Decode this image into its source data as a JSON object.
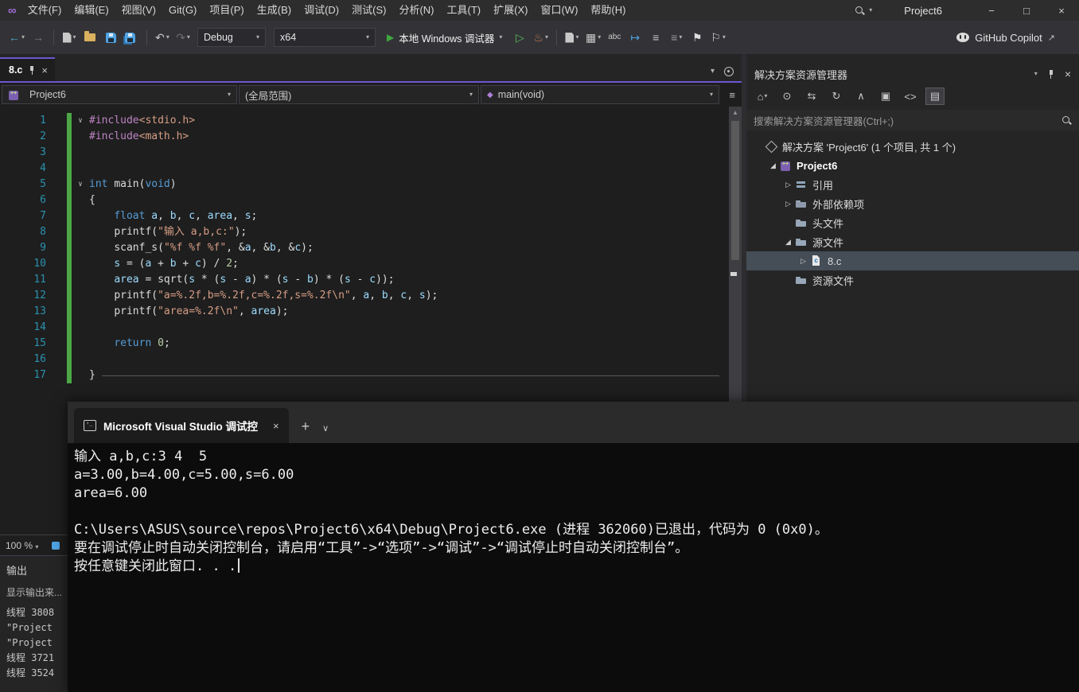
{
  "colors": {
    "accent": "#6E56CF",
    "green_bar": "#4CA646",
    "selection": "#454D57",
    "titlebar_bg": "#2D2D2D",
    "toolbar_bg": "#333337",
    "editor_bg": "#1E1E1E",
    "panel_bg": "#252526",
    "console_bg": "#0C0C0C",
    "debug_green": "#3FA83F",
    "syn_keyword": "#569CD6",
    "syn_string": "#D69D85",
    "syn_number": "#B5CEA8",
    "syn_preproc": "#BD85C4",
    "syn_variable": "#9CDCFE",
    "syn_plain": "#DCDCDC",
    "syn_linenum": "#2B91AF"
  },
  "titlebar": {
    "project_name": "Project6",
    "menus": [
      "文件(F)",
      "编辑(E)",
      "视图(V)",
      "Git(G)",
      "项目(P)",
      "生成(B)",
      "调试(D)",
      "测试(S)",
      "分析(N)",
      "工具(T)",
      "扩展(X)",
      "窗口(W)",
      "帮助(H)"
    ],
    "window_controls": [
      {
        "name": "minimize-button",
        "glyph": "−"
      },
      {
        "name": "maximize-button",
        "glyph": "□"
      },
      {
        "name": "close-button",
        "glyph": "×"
      }
    ]
  },
  "toolbar": {
    "items": [
      {
        "type": "icon",
        "name": "navigate-backward-button",
        "glyph": "←",
        "color": "#4DAACD",
        "caret": true
      },
      {
        "type": "icon",
        "name": "navigate-forward-button",
        "glyph": "→",
        "color": "#7A7A7A"
      },
      {
        "type": "sep"
      },
      {
        "type": "icon",
        "name": "new-project-button",
        "shape": "doc",
        "caret": true
      },
      {
        "type": "icon",
        "name": "open-file-button",
        "shape": "folder"
      },
      {
        "type": "icon",
        "name": "save-button",
        "shape": "floppy"
      },
      {
        "type": "icon",
        "name": "save-all-button",
        "shape": "floppy2"
      },
      {
        "type": "sep"
      },
      {
        "type": "icon",
        "name": "undo-button",
        "glyph": "↶",
        "color": "#C8C8C8",
        "caret": true
      },
      {
        "type": "icon",
        "name": "redo-button",
        "glyph": "↷",
        "color": "#6E6E6E",
        "caret": true
      },
      {
        "type": "combo",
        "name": "solution-configurations-dropdown",
        "value": "Debug",
        "width": 86
      },
      {
        "type": "combo",
        "name": "solution-platforms-dropdown",
        "value": "x64",
        "width": 128
      },
      {
        "type": "run",
        "name": "start-debugging-button",
        "label": "本地 Windows 调试器",
        "caret": true
      },
      {
        "type": "icon",
        "name": "start-without-debugging-button",
        "glyph": "▷",
        "color": "#57B957"
      },
      {
        "type": "icon",
        "name": "hot-reload-button",
        "glyph": "♨",
        "color": "#C97A53",
        "caret": true
      },
      {
        "type": "sep"
      },
      {
        "type": "icon",
        "name": "new-editor-window-button",
        "shape": "doc",
        "caret": true
      },
      {
        "type": "icon",
        "name": "window-layout-button",
        "glyph": "▦",
        "color": "#C8C8C8",
        "caret": true
      },
      {
        "type": "icon",
        "name": "spell-checker-button",
        "glyph": "abc",
        "color": "#C8C8C8"
      },
      {
        "type": "icon",
        "name": "navigate-to-button",
        "glyph": "↦",
        "color": "#4FA3E3"
      },
      {
        "type": "icon",
        "name": "show-whitespace-button",
        "glyph": "≡",
        "color": "#C8C8C8"
      },
      {
        "type": "icon",
        "name": "indent-guides-button",
        "glyph": "≡",
        "color": "#9A9A9A",
        "caret": true
      },
      {
        "type": "icon",
        "name": "toggle-bookmark-button",
        "glyph": "⚑",
        "color": "#DDDDDD"
      },
      {
        "type": "icon",
        "name": "bookmark-window-button",
        "glyph": "⚐",
        "color": "#DDDDDD",
        "caret": true
      },
      {
        "type": "spacer"
      },
      {
        "type": "copilot",
        "name": "github-copilot-button",
        "label": "GitHub Copilot"
      }
    ]
  },
  "editor": {
    "tab_label": "8.c",
    "nav_project": "Project6",
    "nav_scope": "(全局范围)",
    "nav_member": "main(void)",
    "zoom": "100 %",
    "lines": [
      {
        "n": 1,
        "fold": true,
        "segs": [
          [
            "pp",
            "#include"
          ],
          [
            "hdr",
            "<stdio.h>"
          ]
        ]
      },
      {
        "n": 2,
        "segs": [
          [
            "pp",
            "#include"
          ],
          [
            "hdr",
            "<math.h>"
          ]
        ]
      },
      {
        "n": 3,
        "segs": []
      },
      {
        "n": 4,
        "segs": []
      },
      {
        "n": 5,
        "fold": true,
        "segs": [
          [
            "kw",
            "int"
          ],
          [
            "pl",
            " "
          ],
          [
            "fn",
            "main"
          ],
          [
            "pl",
            "("
          ],
          [
            "kw",
            "void"
          ],
          [
            "pl",
            ")"
          ]
        ]
      },
      {
        "n": 6,
        "segs": [
          [
            "pl",
            "{"
          ]
        ]
      },
      {
        "n": 7,
        "segs": [
          [
            "pl",
            "    "
          ],
          [
            "kw",
            "float"
          ],
          [
            "pl",
            " "
          ],
          [
            "var",
            "a"
          ],
          [
            "pl",
            ", "
          ],
          [
            "var",
            "b"
          ],
          [
            "pl",
            ", "
          ],
          [
            "var",
            "c"
          ],
          [
            "pl",
            ", "
          ],
          [
            "var",
            "area"
          ],
          [
            "pl",
            ", "
          ],
          [
            "var",
            "s"
          ],
          [
            "pl",
            ";"
          ]
        ]
      },
      {
        "n": 8,
        "segs": [
          [
            "pl",
            "    "
          ],
          [
            "fn",
            "printf"
          ],
          [
            "pl",
            "("
          ],
          [
            "str",
            "\"输入 a,b,c:\""
          ],
          [
            "pl",
            ");"
          ]
        ]
      },
      {
        "n": 9,
        "segs": [
          [
            "pl",
            "    "
          ],
          [
            "fn",
            "scanf_s"
          ],
          [
            "pl",
            "("
          ],
          [
            "str",
            "\"%f %f %f\""
          ],
          [
            "pl",
            ", &"
          ],
          [
            "var",
            "a"
          ],
          [
            "pl",
            ", &"
          ],
          [
            "var",
            "b"
          ],
          [
            "pl",
            ", &"
          ],
          [
            "var",
            "c"
          ],
          [
            "pl",
            ");"
          ]
        ]
      },
      {
        "n": 10,
        "segs": [
          [
            "pl",
            "    "
          ],
          [
            "var",
            "s"
          ],
          [
            "pl",
            " = ("
          ],
          [
            "var",
            "a"
          ],
          [
            "pl",
            " + "
          ],
          [
            "var",
            "b"
          ],
          [
            "pl",
            " + "
          ],
          [
            "var",
            "c"
          ],
          [
            "pl",
            ") / "
          ],
          [
            "num",
            "2"
          ],
          [
            "pl",
            ";"
          ]
        ]
      },
      {
        "n": 11,
        "segs": [
          [
            "pl",
            "    "
          ],
          [
            "var",
            "area"
          ],
          [
            "pl",
            " = "
          ],
          [
            "fn",
            "sqrt"
          ],
          [
            "pl",
            "("
          ],
          [
            "var",
            "s"
          ],
          [
            "pl",
            " * ("
          ],
          [
            "var",
            "s"
          ],
          [
            "pl",
            " - "
          ],
          [
            "var",
            "a"
          ],
          [
            "pl",
            ") * ("
          ],
          [
            "var",
            "s"
          ],
          [
            "pl",
            " - "
          ],
          [
            "var",
            "b"
          ],
          [
            "pl",
            ") * ("
          ],
          [
            "var",
            "s"
          ],
          [
            "pl",
            " - "
          ],
          [
            "var",
            "c"
          ],
          [
            "pl",
            "));"
          ]
        ]
      },
      {
        "n": 12,
        "segs": [
          [
            "pl",
            "    "
          ],
          [
            "fn",
            "printf"
          ],
          [
            "pl",
            "("
          ],
          [
            "str",
            "\"a=%.2f,b=%.2f,c=%.2f,s=%.2f\\n\""
          ],
          [
            "pl",
            ", "
          ],
          [
            "var",
            "a"
          ],
          [
            "pl",
            ", "
          ],
          [
            "var",
            "b"
          ],
          [
            "pl",
            ", "
          ],
          [
            "var",
            "c"
          ],
          [
            "pl",
            ", "
          ],
          [
            "var",
            "s"
          ],
          [
            "pl",
            ");"
          ]
        ]
      },
      {
        "n": 13,
        "segs": [
          [
            "pl",
            "    "
          ],
          [
            "fn",
            "printf"
          ],
          [
            "pl",
            "("
          ],
          [
            "str",
            "\"area=%.2f\\n\""
          ],
          [
            "pl",
            ", "
          ],
          [
            "var",
            "area"
          ],
          [
            "pl",
            ");"
          ]
        ]
      },
      {
        "n": 14,
        "segs": []
      },
      {
        "n": 15,
        "segs": [
          [
            "pl",
            "    "
          ],
          [
            "kw",
            "return"
          ],
          [
            "pl",
            " "
          ],
          [
            "num",
            "0"
          ],
          [
            "pl",
            ";"
          ]
        ]
      },
      {
        "n": 16,
        "segs": []
      },
      {
        "n": 17,
        "segs": [
          [
            "pl",
            "}"
          ]
        ],
        "endline": true
      }
    ]
  },
  "solution_explorer": {
    "title": "解决方案资源管理器",
    "search_placeholder": "搜索解决方案资源管理器(Ctrl+;)",
    "toolbar": [
      {
        "name": "switch-views-button",
        "glyph": "⌂",
        "caret": true
      },
      {
        "name": "pending-changes-filter-button",
        "glyph": "⊙"
      },
      {
        "name": "sync-with-active-document-button",
        "glyph": "⇆"
      },
      {
        "name": "refresh-button",
        "glyph": "↻"
      },
      {
        "name": "collapse-all-button",
        "glyph": "∧"
      },
      {
        "name": "properties-button",
        "glyph": "▣"
      },
      {
        "name": "view-code-button",
        "glyph": "<>"
      },
      {
        "name": "preview-selected-items-toggle",
        "glyph": "▤",
        "active": true
      }
    ],
    "tree": [
      {
        "label": "解决方案 'Project6' (1 个项目, 共 1 个)",
        "icon": "solution",
        "depth": 0,
        "arrow": ""
      },
      {
        "label": "Project6",
        "icon": "project",
        "depth": 1,
        "arrow": "expanded",
        "bold": true
      },
      {
        "label": "引用",
        "icon": "references",
        "depth": 2,
        "arrow": "collapsed"
      },
      {
        "label": "外部依赖项",
        "icon": "dependencies",
        "depth": 2,
        "arrow": "collapsed"
      },
      {
        "label": "头文件",
        "icon": "folder",
        "depth": 2,
        "arrow": ""
      },
      {
        "label": "源文件",
        "icon": "folder",
        "depth": 2,
        "arrow": "expanded"
      },
      {
        "label": "8.c",
        "icon": "c-file",
        "depth": 3,
        "arrow": "collapsed",
        "selected": true
      },
      {
        "label": "资源文件",
        "icon": "folder",
        "depth": 2,
        "arrow": ""
      }
    ]
  },
  "console": {
    "tab_label": "Microsoft Visual Studio 调试控",
    "lines": [
      "输入 a,b,c:3 4  5",
      "a=3.00,b=4.00,c=5.00,s=6.00",
      "area=6.00",
      "",
      "C:\\Users\\ASUS\\source\\repos\\Project6\\x64\\Debug\\Project6.exe (进程 362060)已退出，代码为 0 (0x0)。",
      "要在调试停止时自动关闭控制台，请启用“工具”->“选项”->“调试”->“调试停止时自动关闭控制台”。",
      "按任意键关闭此窗口. . ."
    ]
  },
  "output": {
    "title": "输出",
    "source_label": "显示输出来...",
    "lines": [
      "线程 3808",
      "\"Project",
      "\"Project",
      "线程 3721",
      "线程 3524"
    ]
  }
}
